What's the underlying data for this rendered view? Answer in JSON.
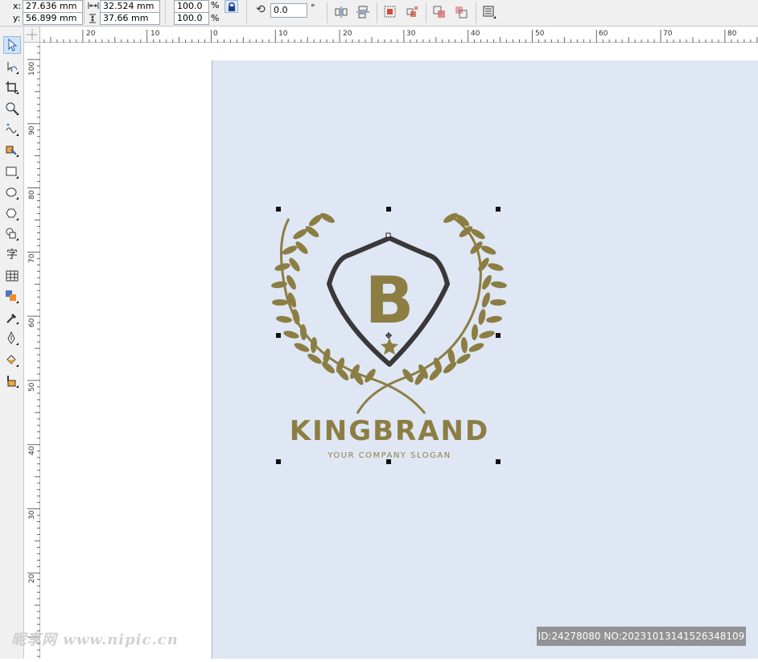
{
  "propbar": {
    "x_label": "x:",
    "x_value": "27.636 mm",
    "y_label": "y:",
    "y_value": "56.899 mm",
    "width_value": "32.524 mm",
    "height_value": "37.66 mm",
    "scale_x": "100.0",
    "scale_y": "100.0",
    "percent": "%",
    "rotation": "0.0",
    "degree": "°"
  },
  "ruler": {
    "h_labels": [
      "20",
      "10",
      "0",
      "10",
      "20",
      "30",
      "40",
      "50",
      "60",
      "70",
      "80"
    ],
    "v_labels": [
      "100",
      "90",
      "80",
      "70",
      "60",
      "50",
      "40",
      "30",
      "20"
    ]
  },
  "logo": {
    "brand": "KINGBRAND",
    "slogan": "YOUR COMPANY SLOGAN",
    "monogram": "B",
    "gold_color": "#8c7e43",
    "shield_color": "#3a3838"
  },
  "page_color": "#dfe7f5",
  "watermark": {
    "id_text": "ID:24278080 NO:20231013141526348109",
    "site_text": "昵享网 www.nipic.cn"
  }
}
